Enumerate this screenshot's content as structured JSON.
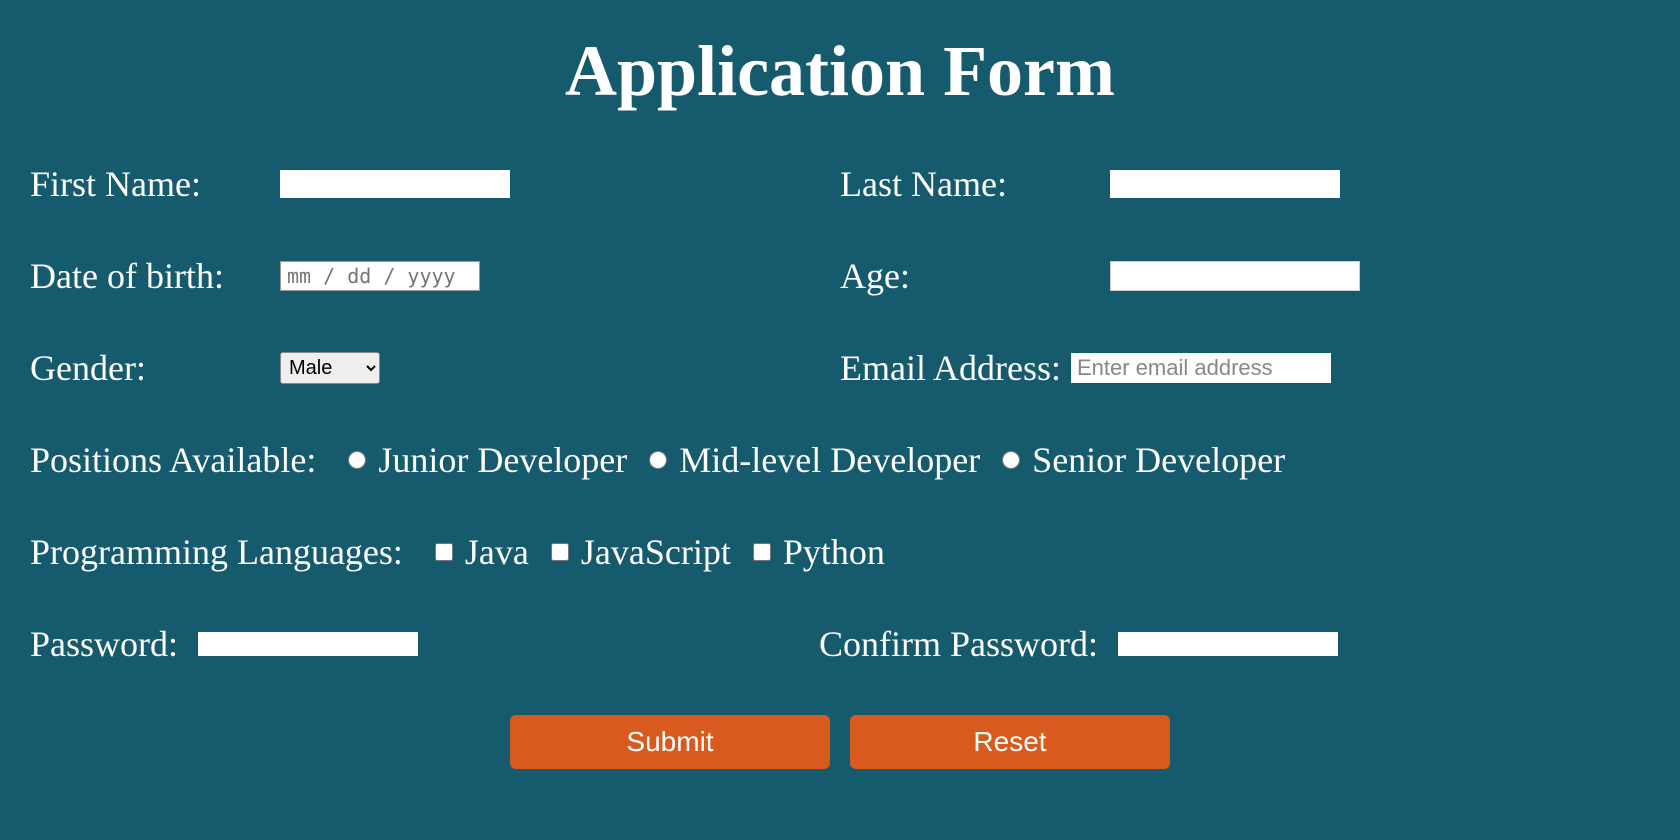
{
  "title": "Application Form",
  "fields": {
    "first_name": {
      "label": "First Name:",
      "value": ""
    },
    "last_name": {
      "label": "Last Name:",
      "value": ""
    },
    "dob": {
      "label": "Date of birth:",
      "placeholder": "mm / dd / yyyy",
      "value": ""
    },
    "age": {
      "label": "Age:",
      "value": ""
    },
    "gender": {
      "label": "Gender:",
      "selected": "Male",
      "options": [
        "Male"
      ]
    },
    "email": {
      "label": "Email Address:",
      "placeholder": "Enter email address",
      "value": ""
    },
    "positions": {
      "label": "Positions Available:",
      "options": [
        "Junior Developer",
        "Mid-level Developer",
        "Senior Developer"
      ]
    },
    "languages": {
      "label": "Programming Languages:",
      "options": [
        "Java",
        "JavaScript",
        "Python"
      ]
    },
    "password": {
      "label": "Password:",
      "value": ""
    },
    "confirm_password": {
      "label": "Confirm Password:",
      "value": ""
    }
  },
  "buttons": {
    "submit": "Submit",
    "reset": "Reset"
  }
}
